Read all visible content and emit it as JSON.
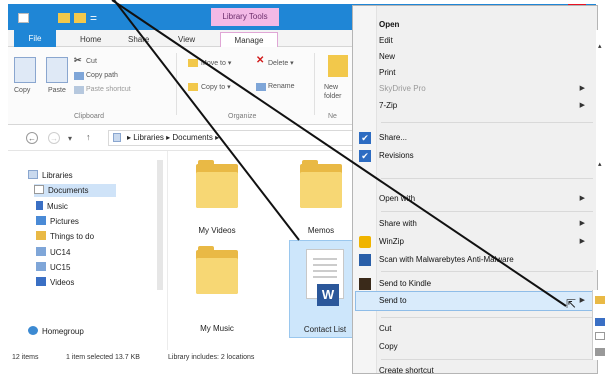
{
  "window": {
    "library_tools": "Library Tools",
    "tabs": [
      "File",
      "Home",
      "Share",
      "View",
      "Manage"
    ],
    "help": "?"
  },
  "ribbon": {
    "copy": "Copy",
    "paste": "Paste",
    "cut": "Cut",
    "copy_path": "Copy path",
    "paste_shortcut": "Paste shortcut",
    "move_to": "Move to ▾",
    "delete": "Delete ▾",
    "copy_to": "Copy to ▾",
    "rename": "Rename",
    "new_folder": "New folder",
    "groups": [
      "Clipboard",
      "Organize",
      "Ne"
    ]
  },
  "address": {
    "path": "▸  Libraries  ▸  Documents  ▸"
  },
  "nav": {
    "items": [
      "Libraries",
      "Documents",
      "Music",
      "Pictures",
      "Things to do",
      "UC14",
      "UC15",
      "Videos",
      "Homegroup"
    ]
  },
  "files": {
    "my_videos": "My Videos",
    "memos": "Memos",
    "my_music": "My Music",
    "contact_list": "Contact List",
    "word_badge": "W"
  },
  "status": {
    "items": "12 items",
    "selected": "1 item selected  13.7 KB",
    "library": "Library includes: 2 locations"
  },
  "context_menu": {
    "open": "Open",
    "edit": "Edit",
    "new": "New",
    "print": "Print",
    "skydrive": "SkyDrive Pro",
    "sevenzip": "7-Zip",
    "share": "Share...",
    "revisions": "Revisions",
    "open_with": "Open with",
    "share_with": "Share with",
    "winzip": "WinZip",
    "malwarebytes": "Scan with Malwarebytes Anti-Malware",
    "send_to_kindle": "Send to Kindle",
    "send_to": "Send to",
    "cut": "Cut",
    "copy": "Copy",
    "create_shortcut": "Create shortcut"
  },
  "colors": {
    "title_blue": "#1f86d6",
    "manage_pink": "#f3b9e6",
    "selection": "#d9ebfb",
    "word_blue": "#2b579a"
  }
}
